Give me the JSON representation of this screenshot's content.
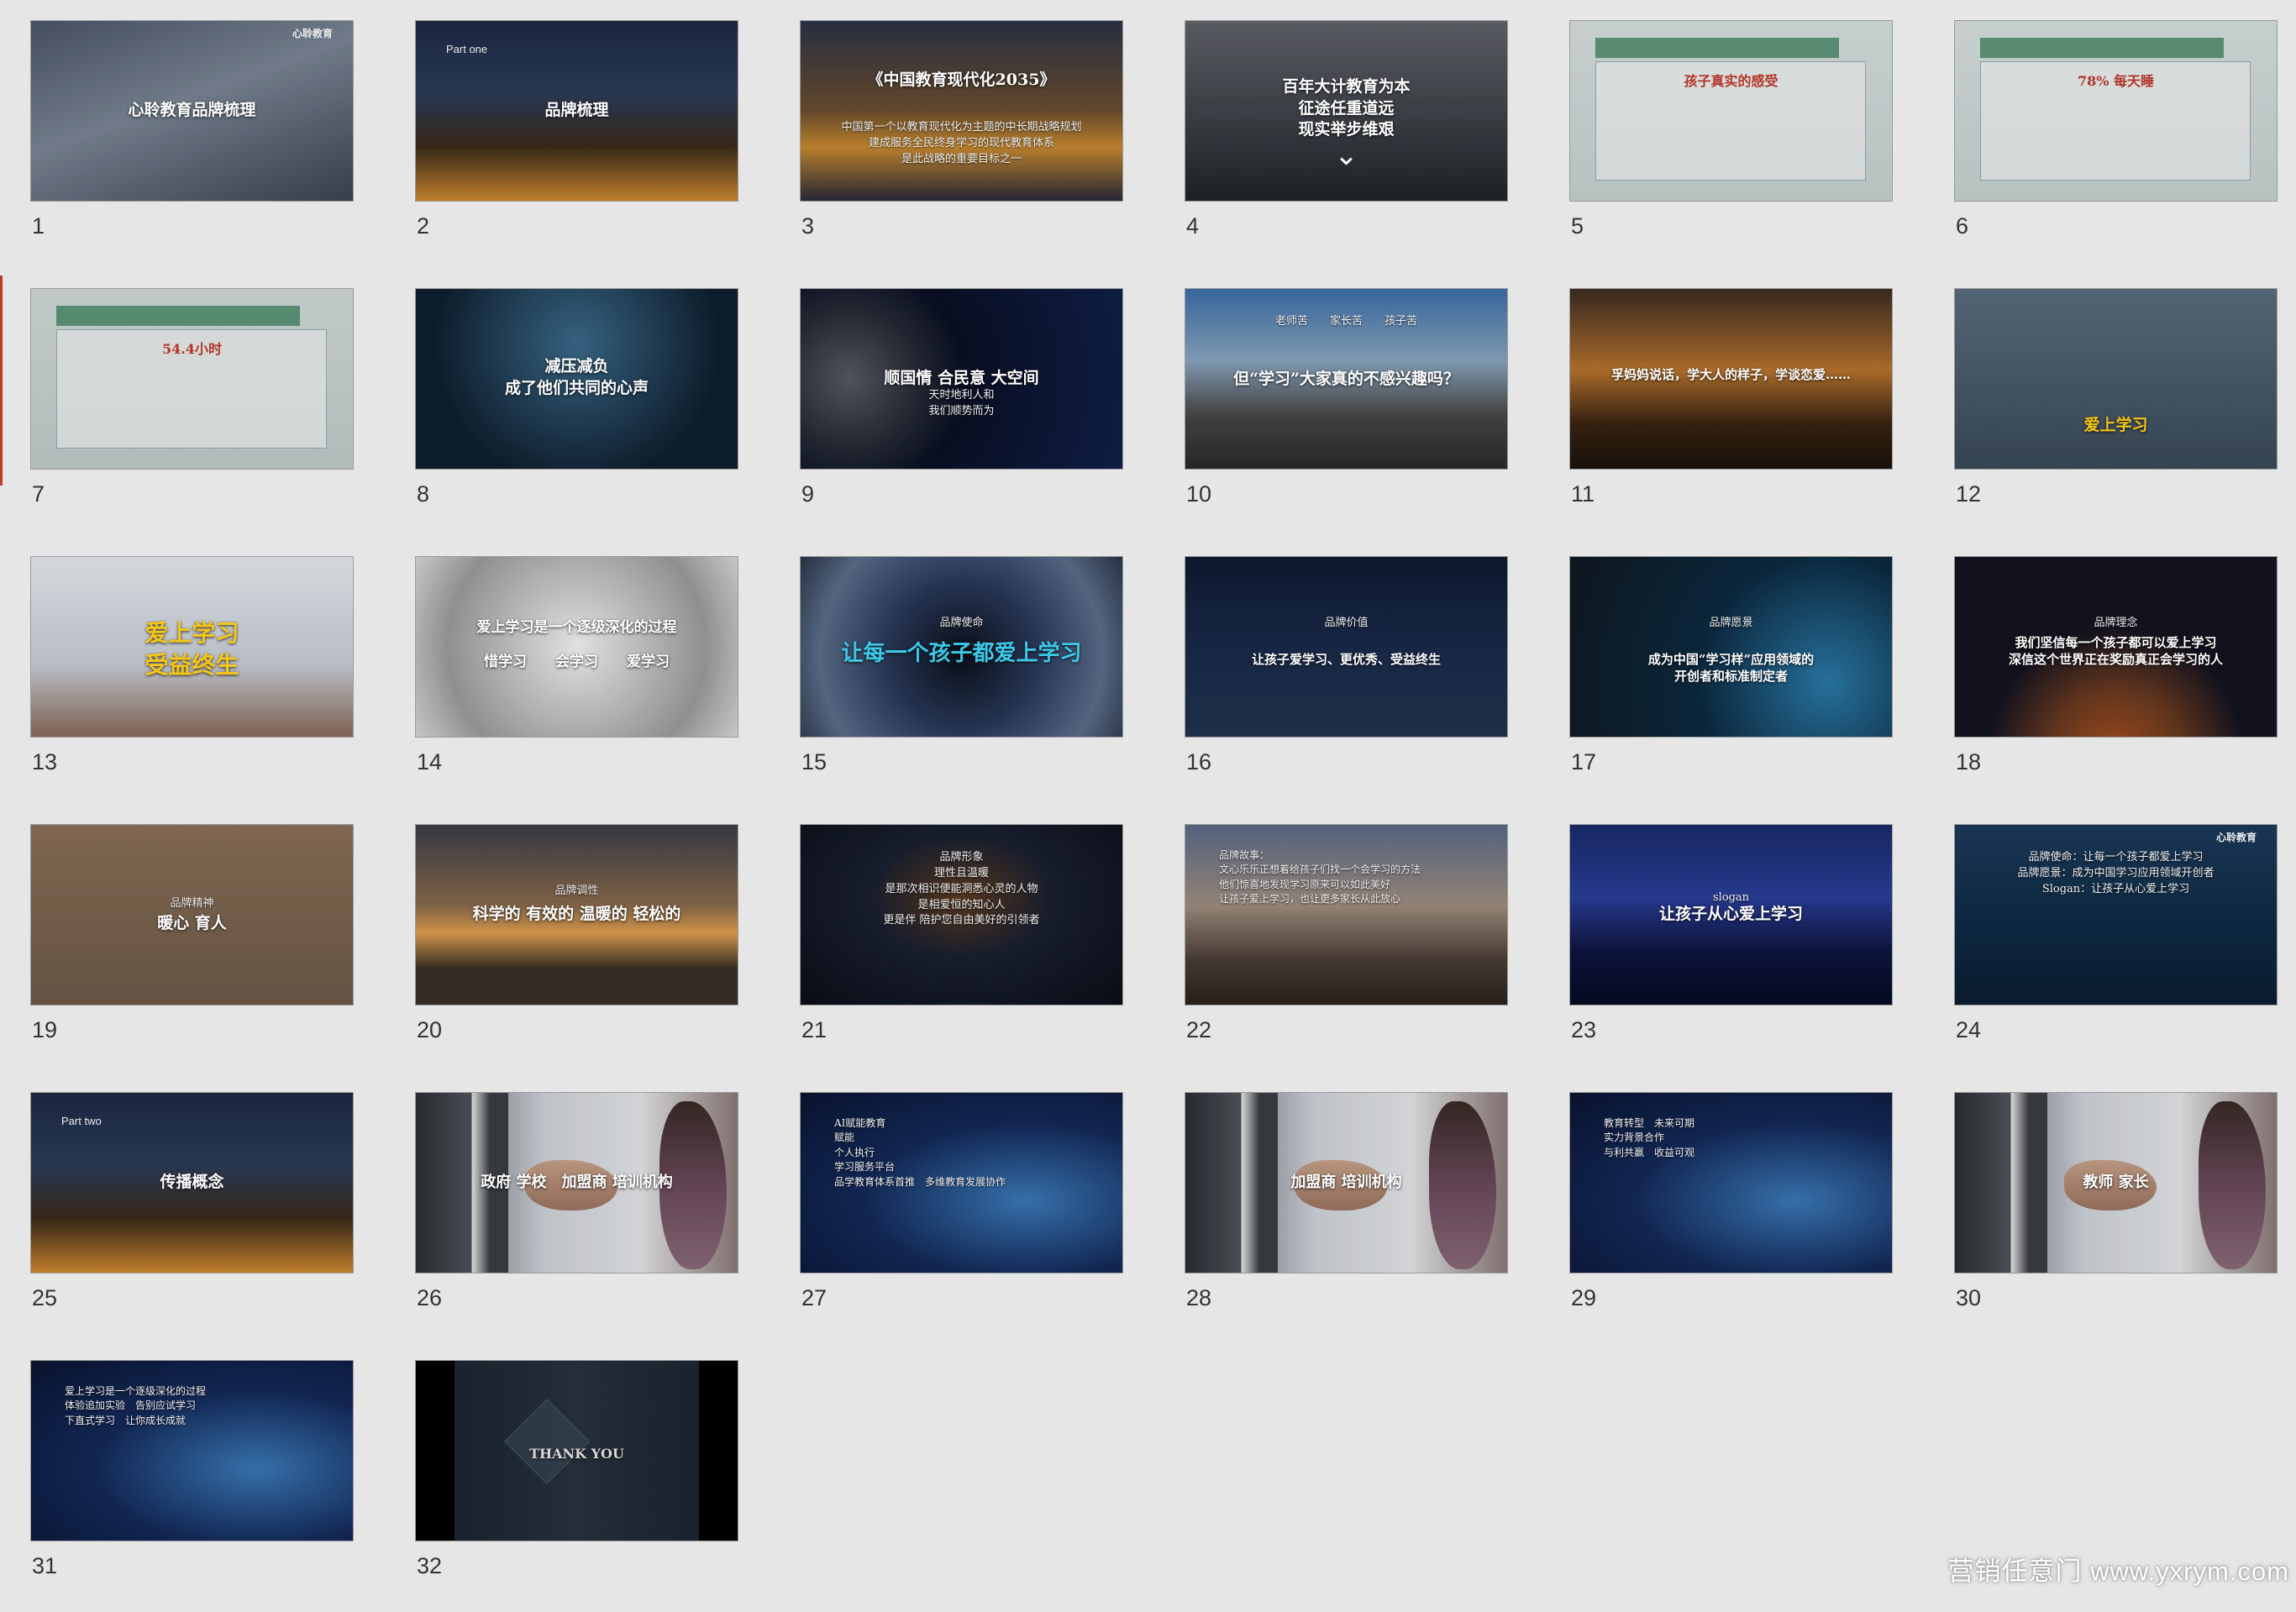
{
  "watermark": "营销任意门 www.yxrym.com",
  "slides": [
    {
      "num": "1",
      "bg": "linear-gradient(160deg,#4a5568,#7a8594 45%,#3b4452)",
      "title": "心聆教育品牌梳理",
      "sub": "",
      "logo": "心聆教育"
    },
    {
      "num": "2",
      "bg": "linear-gradient(180deg,#1d2a44,#2d3c5a 40%,#3a2a1a 70%,#d08a30)",
      "title": "品牌梳理",
      "sub": "",
      "part": "Part one"
    },
    {
      "num": "3",
      "bg": "linear-gradient(180deg,#2b3247,#6b4e2e 50%,#c88a30 70%,#2b2a3a)",
      "title": "《中国教育现代化2035》",
      "sub": "中国第一个以教育现代化为主题的中长期战略规划|建成服务全民终身学习的现代教育体系|是此战略的重要目标之一"
    },
    {
      "num": "4",
      "bg": "linear-gradient(180deg,#60646a,#3a3e44 60%,#202428)",
      "title": "百年大计教育为本|征途任重道远|现实举步维艰",
      "sub": "",
      "chev": true
    },
    {
      "num": "5",
      "bg": "linear-gradient(180deg,#d7e1df,#c7d3d1)",
      "title": "",
      "sub": "",
      "info": "孩子真实的感受"
    },
    {
      "num": "6",
      "bg": "linear-gradient(180deg,#d7e1df,#c7d3d1)",
      "title": "",
      "sub": "",
      "info": "78% 每天睡"
    },
    {
      "num": "7",
      "bg": "linear-gradient(180deg,#d1dbd8,#c1cdca)",
      "title": "",
      "sub": "",
      "info": "54.4小时"
    },
    {
      "num": "8",
      "bg": "radial-gradient(circle at 50% 30%,#3a6a8a,#0f1f2e 70%)",
      "title": "减压减负|成了他们共同的心声",
      "sub": ""
    },
    {
      "num": "9",
      "bg": "radial-gradient(circle at 15% 50%,#555a66 0,#2a2e38 22%,#0a1024 40%,#11204a)",
      "title": "顺国情 合民意 大空间",
      "sub": "天时地利人和|我们顺势而为"
    },
    {
      "num": "10",
      "bg": "linear-gradient(180deg,#3c6fa8,#8aa6c0 40%,#4a4846 70%,#2a2a2a)",
      "title": "但“学习”大家真的不感兴趣吗？",
      "sub": "老师苦　　家长苦　　孩子苦"
    },
    {
      "num": "11",
      "bg": "linear-gradient(180deg,#3a2c22,#b8742e 45%,#3a2412 75%,#1a120a)",
      "title": "孚妈妈说话，学大人的样子，学谈恋爱……",
      "sub": ""
    },
    {
      "num": "12",
      "bg": "linear-gradient(180deg,#5a6e7e,#3a4a58)",
      "title": "爱上学习",
      "sub": ""
    },
    {
      "num": "13",
      "bg": "linear-gradient(180deg,#e6ebf0,#c8ced6 60%,#8a6a5a)",
      "title": "爱上学习|受益终生",
      "sub": "",
      "gold": true
    },
    {
      "num": "14",
      "bg": "radial-gradient(circle,#f4f4f4 0,#c8c8c8 35%,#9c9c9c 70%,#d8d8d8)",
      "title": "爱上学习是一个逐级深化的过程|惜学习　　会学习　　爱学习",
      "sub": ""
    },
    {
      "num": "15",
      "bg": "radial-gradient(circle at 50% 55%,#0b0f1a 0,#2a3a5a 40%,#5a6e8a 75%,#2a3446)",
      "title": "让每一个孩子都爱上学习",
      "sub": "品牌使命",
      "cyan": true
    },
    {
      "num": "16",
      "bg": "linear-gradient(180deg,#0f1a30,#1a2a4a 50%,#22324e)",
      "title": "让孩子爱学习、更优秀、受益终生",
      "sub": "品牌价值"
    },
    {
      "num": "17",
      "bg": "radial-gradient(circle at 80% 70%,#2a7aa8,#0c2a40 45%,#101820)",
      "title": "成为中国“学习样”应用领域的|开创者和标准制定者",
      "sub": "品牌愿景"
    },
    {
      "num": "18",
      "bg": "radial-gradient(circle at 50% 110%,#a8501e 0,#6a3a20 25%,#141420 50%)",
      "title": "我们坚信每一个孩子都可以爱上学习|深信这个世界正在奖励真正会学习的人",
      "sub": "品牌理念"
    },
    {
      "num": "19",
      "bg": "linear-gradient(180deg,#8a7058,#6e5a48)",
      "title": "暖心 育人",
      "sub": "品牌精神"
    },
    {
      "num": "20",
      "bg": "linear-gradient(180deg,#3a3e48,#8a6a4a 45%,#e0a050 60%,#3a3026 80%)",
      "title": "科学的 有效的 温暖的 轻松的",
      "sub": "品牌调性"
    },
    {
      "num": "21",
      "bg": "radial-gradient(ellipse at 50% 40%,#5a3a20 0,#1a2030 40%,#0a0e18)",
      "title": "",
      "sub": "品牌形象|理性且温暖|是那次相识便能洞悉心灵的人物|是相爱恒的知心人|更是伴 陪护您自由美好的引领者"
    },
    {
      "num": "22",
      "bg": "linear-gradient(180deg,#5a6a88,#a08e80 45%,#4a3e36 75%,#2a221c)",
      "title": "",
      "sub": "品牌故事：|文心乐乐正想着给孩子们找一个会学习的方法|他们惊喜地发现学习原来可以如此美好|让孩子爱上学习，也让更多家长从此放心",
      "left": true
    },
    {
      "num": "23",
      "bg": "linear-gradient(180deg,#1a2a6a,#2a3e9a 40%,#0e1640 70%,#050a22)",
      "title": "让孩子从心爱上学习",
      "sub": "slogan"
    },
    {
      "num": "24",
      "bg": "linear-gradient(180deg,#1a3a5a,#0f2a44 60%,#0a1e30)",
      "title": "",
      "sub": "品牌使命：让每一个孩子都爱上学习|品牌愿景：成为中国学习应用领域开创者|Slogan：让孩子从心爱上学习",
      "logo": "心聆教育"
    },
    {
      "num": "25",
      "bg": "linear-gradient(180deg,#1d2a44,#2d3c5a 40%,#3a2a1a 70%,#d08a30)",
      "title": "传播概念",
      "sub": "",
      "part": "Part two"
    },
    {
      "num": "26",
      "bg": "linear-gradient(90deg,#4a4e54,#cfd4da 40%,#e4e6e8 70%,#8a7a78)",
      "title": "政府 学校　加盟商 培训机构",
      "sub": "",
      "hands": true
    },
    {
      "num": "27",
      "bg": "radial-gradient(ellipse at 70% 60%,#3a7ab8,#142a5a 50%,#0a1430)",
      "title": "",
      "sub": "AI赋能教育|赋能|个人执行|学习服务平台|品学教育体系首推　多维教育发展协作",
      "left": true
    },
    {
      "num": "28",
      "bg": "linear-gradient(90deg,#4a4e54,#cfd4da 40%,#e4e6e8 70%,#8a7a78)",
      "title": "加盟商 培训机构",
      "sub": "",
      "hands": true
    },
    {
      "num": "29",
      "bg": "radial-gradient(ellipse at 70% 60%,#3a7ab8,#142a5a 50%,#0a1430)",
      "title": "",
      "sub": "教育转型　未来可期|实力背景合作|与利共赢　收益可观",
      "left": true
    },
    {
      "num": "30",
      "bg": "linear-gradient(90deg,#4a4e54,#cfd4da 40%,#e4e6e8 70%,#8a7a78)",
      "title": "教师 家长",
      "sub": "",
      "hands": true
    },
    {
      "num": "31",
      "bg": "radial-gradient(ellipse at 70% 60%,#3a7ab8,#142a5a 50%,#0a1430)",
      "title": "",
      "sub": "爱上学习是一个逐级深化的过程|体验追加实验　告别应试学习|下直式学习　让你成长成就",
      "left": true
    },
    {
      "num": "32",
      "bg": "linear-gradient(90deg,#000 0,#000 12%,#1c2632 12%,#26323e 50%,#1c2632 88%,#000 88%)",
      "title": "THANK YOU",
      "sub": "",
      "thanks": true
    }
  ]
}
